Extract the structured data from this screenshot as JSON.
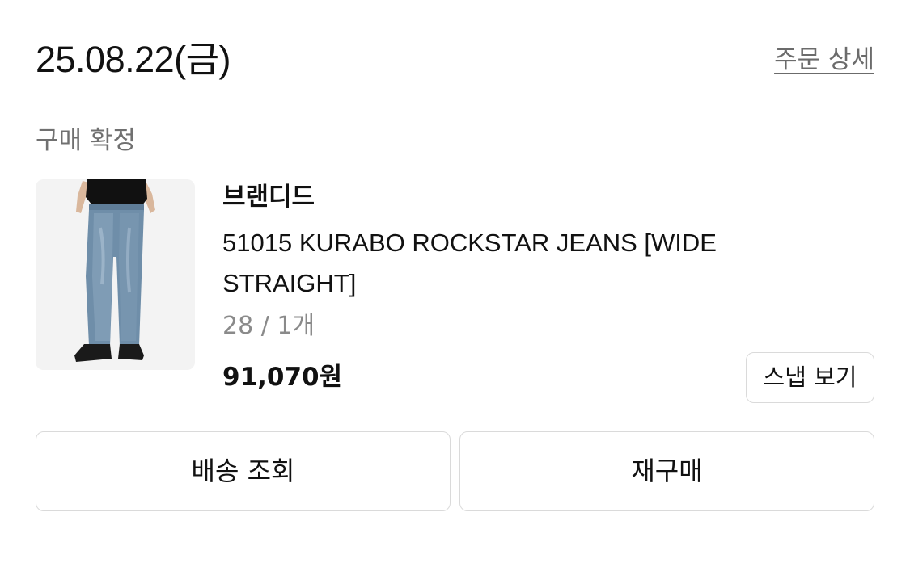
{
  "order": {
    "date": "25.08.22(금)",
    "detail_link": "주문 상세",
    "status": "구매 확정"
  },
  "product": {
    "image_icon": "product-photo-jeans",
    "brand": "브랜디드",
    "name": "51015 KURABO ROCKSTAR JEANS [WIDE STRAIGHT]",
    "option": "28 / 1개",
    "price": "91,070원",
    "snap_button": "스냅 보기"
  },
  "actions": {
    "track_delivery": "배송 조회",
    "reorder": "재구매"
  }
}
